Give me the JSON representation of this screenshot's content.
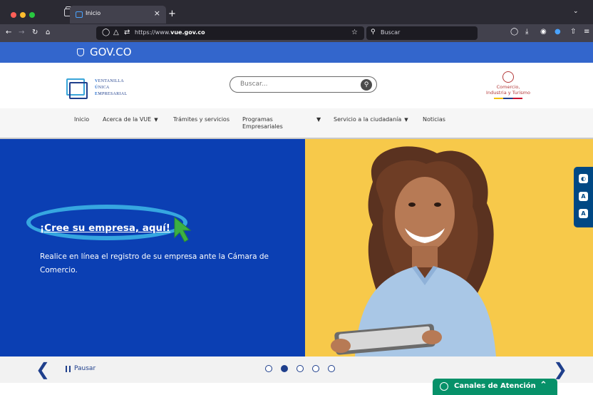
{
  "browser": {
    "tab_title": "Inicio",
    "tab_close": "×",
    "new_tab": "+",
    "url_prefix": "https://www.",
    "url_domain": "vue.gov.co",
    "search_placeholder": "Buscar",
    "icons": [
      "tab-overview-icon",
      "back-icon",
      "forward-icon",
      "reload-icon",
      "home-icon",
      "shield-icon",
      "lock-icon",
      "permissions-icon",
      "bookmark-star-icon",
      "search-icon",
      "pocket-icon",
      "download-icon",
      "account-icon",
      "extension-icon",
      "share-icon",
      "menu-icon",
      "tab-list-chevron-icon"
    ]
  },
  "gov": {
    "logo_text": "GOV.CO"
  },
  "header": {
    "vue_logo": {
      "line1_cap": "V",
      "line1": "ENTANILLA",
      "line2_cap": "Ú",
      "line2": "NICA",
      "line3_cap": "E",
      "line3": "MPRESARIAL"
    },
    "search_placeholder": "Buscar...",
    "ministry_line1": "Comercio,",
    "ministry_line2": "Industria y Turismo"
  },
  "nav": {
    "items": [
      {
        "label": "Inicio",
        "dropdown": false
      },
      {
        "label": "Acerca de la VUE",
        "dropdown": true
      },
      {
        "label": "Trámites y servicios",
        "dropdown": false
      },
      {
        "label": "Programas Empresariales",
        "label_line1": "Programas",
        "label_line2": "Empresariales",
        "dropdown": true
      },
      {
        "label": "Servicio a la ciudadanía",
        "dropdown": true
      },
      {
        "label": "Noticias",
        "dropdown": false
      }
    ]
  },
  "hero": {
    "link_text": "¡Cree su empresa, aquí!",
    "description": "Realice en línea el registro de su empresa ante la Cámara de Comercio.",
    "colors": {
      "left": "#0b3fb3",
      "right": "#f7c94a",
      "highlight": "#36a6e0",
      "cursor": "#3cb043"
    }
  },
  "carousel": {
    "pause_label": "Pausar",
    "slide_count": 5,
    "active_slide": 2
  },
  "accessibility": {
    "buttons": [
      "contrast-icon",
      "font-increase-icon",
      "font-decrease-icon"
    ]
  },
  "support": {
    "label": "Canales de Atención"
  }
}
